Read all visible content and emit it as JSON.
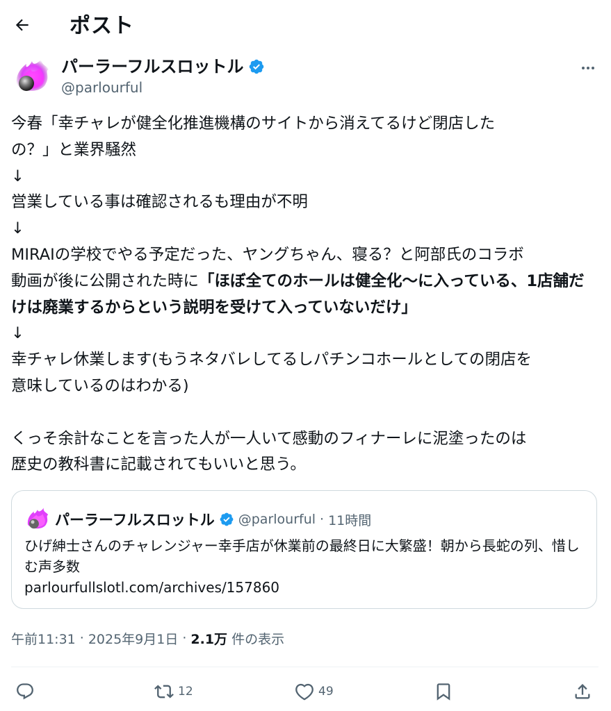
{
  "header": {
    "title": "ポスト",
    "back_icon": "arrow-left-icon"
  },
  "author": {
    "name": "パーラーフルスロットル",
    "handle": "@parlourful",
    "verified": true,
    "verified_color": "#1d9bf0"
  },
  "post": {
    "line1": "今春「幸チャレが健全化推進機構のサイトから消えてるけど閉店した",
    "line2": "の？」と業界騒然",
    "arrow": "↓",
    "line3": "営業している事は確認されるも理由が不明",
    "line4": "MIRAIの学校でやる予定だった、ヤングちゃん、寝る？と阿部氏のコラボ",
    "line5": "動画が後に公開された時に",
    "bold_quote": "「ほぼ全てのホールは健全化〜に入っている、1店舗だけは廃業するからという説明を受けて入っていないだけ」",
    "line6": "幸チャレ休業します(もうネタバレしてるしパチンコホールとしての閉店を",
    "line7": "意味しているのはわかる)",
    "line8": "くっそ余計なことを言った人が一人いて感動のフィナーレに泥塗ったのは",
    "line9": "歴史の教科書に記載されてもいいと思う。"
  },
  "quote": {
    "name": "パーラーフルスロットル",
    "handle": "@parlourful",
    "separator": "·",
    "time": "11時間",
    "text": "ひげ紳士さんのチャレンジャー幸手店が休業前の最終日に大繁盛！朝から長蛇の列、惜しむ声多数",
    "url": "parlourfullslotl.com/archives/157860"
  },
  "meta": {
    "time": "午前11:31",
    "sep": "·",
    "date": "2025年9月1日",
    "views_count": "2.1万",
    "views_label": "件の表示"
  },
  "actions": {
    "reply": {
      "icon": "reply-icon",
      "count": ""
    },
    "repost": {
      "icon": "repost-icon",
      "count": "12"
    },
    "like": {
      "icon": "heart-icon",
      "count": "49"
    },
    "bookmark": {
      "icon": "bookmark-icon",
      "count": ""
    },
    "share": {
      "icon": "share-icon",
      "count": ""
    }
  },
  "colors": {
    "text": "#0f1419",
    "secondary": "#536471",
    "border": "#cfd9de",
    "accent": "#1d9bf0",
    "avatar_glow": "#e040fb"
  }
}
